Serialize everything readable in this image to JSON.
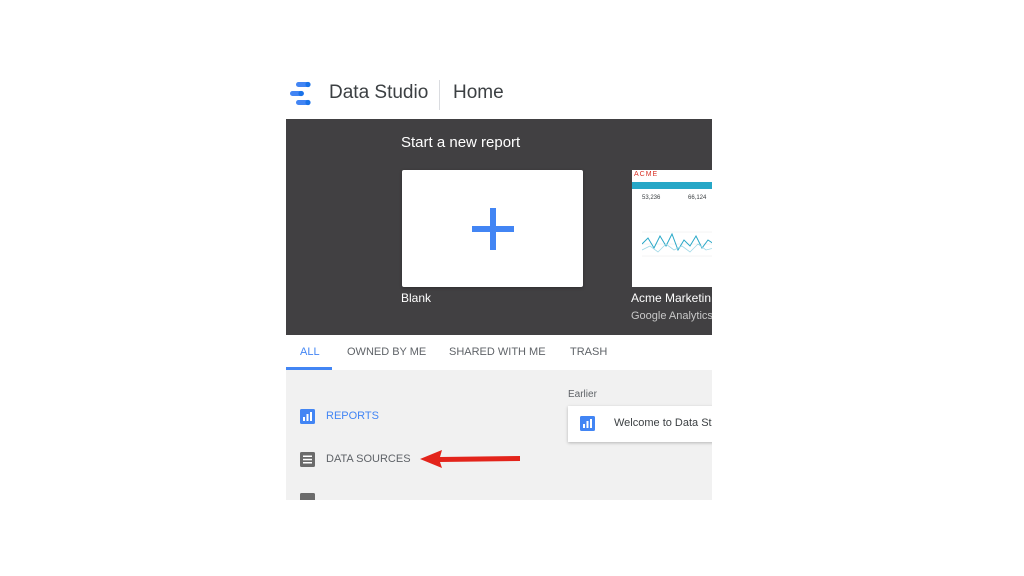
{
  "header": {
    "app_name": "Data Studio",
    "page_name": "Home"
  },
  "hero": {
    "title": "Start a new report",
    "blank_label": "Blank",
    "template": {
      "brand": "ACME",
      "metric_1": "53,236",
      "metric_2": "66,124",
      "label": "Acme Marketin",
      "source": "Google Analytics"
    }
  },
  "tabs": [
    "ALL",
    "OWNED BY ME",
    "SHARED WITH ME",
    "TRASH"
  ],
  "sidebar": {
    "items": [
      {
        "label": "REPORTS",
        "icon": "bar-chart-icon"
      },
      {
        "label": "DATA SOURCES",
        "icon": "list-icon"
      }
    ]
  },
  "main": {
    "section": "Earlier",
    "report": {
      "title": "Welcome to Data St",
      "icon": "bar-chart-icon"
    }
  },
  "colors": {
    "accent": "#4285f4",
    "hero_bg": "#414042",
    "arrow": "#e3241b"
  }
}
